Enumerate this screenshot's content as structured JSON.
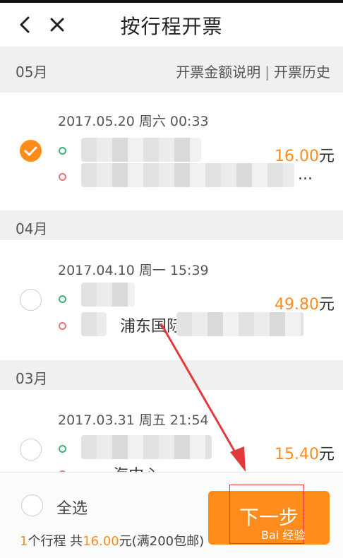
{
  "header": {
    "title": "按行程开票",
    "back_icon": "chevron-left-icon",
    "close_icon": "close-icon"
  },
  "months": [
    {
      "label": "05月",
      "links": {
        "amount_note": "开票金额说明",
        "separator": "|",
        "history": "开票历史"
      }
    },
    {
      "label": "04月"
    },
    {
      "label": "03月"
    }
  ],
  "trips": [
    {
      "datetime": "2017.05.20 周六 00:33",
      "checked": true,
      "price": "16.00",
      "currency": "元",
      "from_text": "",
      "to_text": "..."
    },
    {
      "datetime": "2017.04.10 周一 15:39",
      "checked": false,
      "price": "49.80",
      "currency": "元",
      "from_text": "",
      "to_text": "浦东国际"
    },
    {
      "datetime": "2017.03.31 周五 21:54",
      "checked": false,
      "price": "15.40",
      "currency": "元",
      "from_text": "",
      "to_text": "海中心"
    }
  ],
  "footer": {
    "select_all": "全选",
    "count": "1",
    "trips_label": "个行程 共",
    "total": "16.00",
    "suffix": "元(满200包邮)",
    "next_button": "下一步"
  },
  "watermark": "Bai 经验",
  "colors": {
    "accent": "#ff8c1a",
    "origin_dot": "#3cb37a",
    "destination_dot": "#e8737a"
  }
}
